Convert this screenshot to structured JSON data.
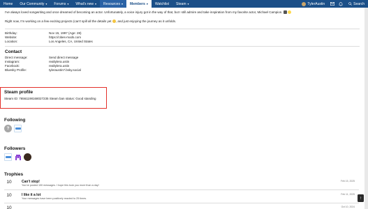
{
  "nav": {
    "items": [
      {
        "label": "Home",
        "caret": false
      },
      {
        "label": "Our Community",
        "caret": true
      },
      {
        "label": "Forums",
        "caret": true
      },
      {
        "label": "What's new",
        "caret": true
      },
      {
        "label": "Resources",
        "caret": true
      },
      {
        "label": "Members",
        "caret": true
      },
      {
        "label": "Watchlist",
        "caret": false
      },
      {
        "label": "Steam",
        "caret": true
      }
    ],
    "user_name": "TylerAustin",
    "search_label": "Search"
  },
  "bio": {
    "line1": "I've always loved songwriting and once dreamed of becoming an actor. Unfortunately, a voice injury got in the way of that, but I still admire and take inspiration from my favorite actor, Michael Campion.",
    "line2a": "Right now, I'm working on a few exciting projects (can't spill all the details yet",
    "line2b": ", and just enjoying the journey as it unfolds."
  },
  "about": {
    "rows": [
      {
        "label": "Birthday:",
        "value": "Nov 15, 1997 (Age: 28)"
      },
      {
        "label": "Website:",
        "value": "https://cities-mods.com"
      },
      {
        "label": "Location:",
        "value": "Los Angeles, CA, United States"
      }
    ]
  },
  "contact": {
    "title": "Contact",
    "rows": [
      {
        "label": "Direct message:",
        "value": "Send direct message"
      },
      {
        "label": "Instagram:",
        "value": "realtylera.ustin"
      },
      {
        "label": "Facebook:",
        "value": "realtylera.ustin"
      },
      {
        "label": "Bluesky Profile:",
        "value": "tyleraustin7.bsky.social"
      }
    ]
  },
  "steam": {
    "title": "Steam profile",
    "line": "Steam ID: 76561198168027235 Steam ban status: Good standing"
  },
  "following": {
    "title": "Following",
    "question_glyph": "?"
  },
  "followers": {
    "title": "Followers"
  },
  "trophies": {
    "title": "Trophies",
    "items": [
      {
        "points": "10",
        "title": "Can't stop!",
        "desc": "You've posted 100 messages. I hope this took you more than a day!",
        "date": "Feb 15, 2025"
      },
      {
        "points": "10",
        "title": "I like it a lot",
        "desc": "Your messages have been positively reacted to 25 times.",
        "date": "Feb 11, 2025"
      },
      {
        "points": "10",
        "title": "",
        "desc": "",
        "date": "Oct 10, 2024"
      }
    ]
  },
  "colors": {
    "nav_bg": "#1b4f88",
    "highlight_border": "#e4302a",
    "panel_bg": "#ffffff"
  },
  "scroll_top_glyph": "↑"
}
